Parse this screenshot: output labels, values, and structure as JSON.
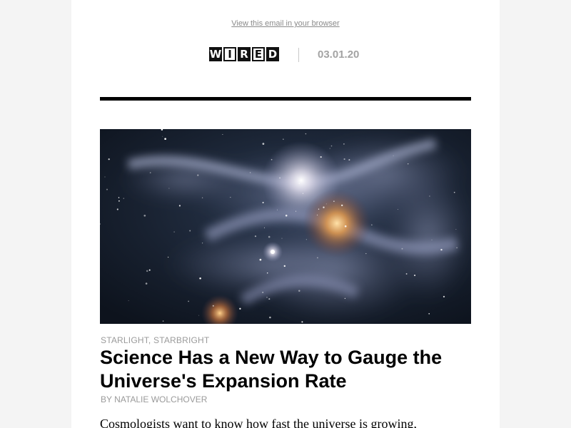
{
  "header": {
    "view_in_browser": "View this email in your browser",
    "logo_letters": [
      "W",
      "I",
      "R",
      "E",
      "D"
    ],
    "date": "03.01.20"
  },
  "article": {
    "kicker": "STARLIGHT, STARBRIGHT",
    "headline": "Science Has a New Way to Gauge the Universe's Expansion Rate",
    "byline": "BY NATALIE WOLCHOVER",
    "dek": "Cosmologists want to know how fast the universe is growing,"
  },
  "colors": {
    "page_background": "#f4f4f4",
    "email_background": "#ffffff",
    "meta_gray": "#9a9a9a",
    "rule": "#000000"
  },
  "icons": {
    "logo": "wired-logo",
    "hero": "nebula-image"
  }
}
